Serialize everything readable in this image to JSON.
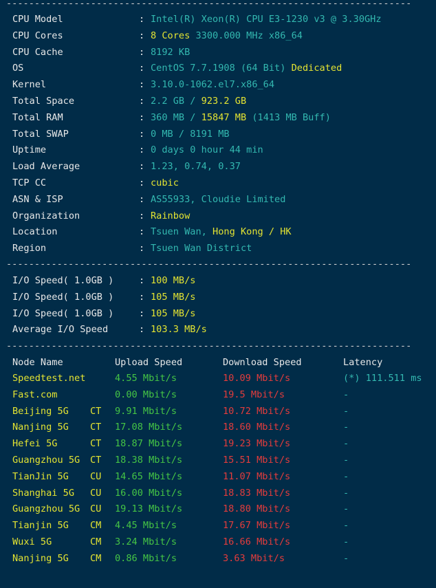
{
  "top_separator": "------------------------------------------------------------------------",
  "system_info": [
    {
      "label": "CPU Model",
      "parts": [
        {
          "text": "Intel(R) Xeon(R) CPU E3-1230 v3 @ 3.30GHz",
          "color": "#33b8b0"
        }
      ]
    },
    {
      "label": "CPU Cores",
      "parts": [
        {
          "text": "8 Cores ",
          "color": "#e4e432"
        },
        {
          "text": "3300.000 MHz x86_64",
          "color": "#33b8b0"
        }
      ]
    },
    {
      "label": "CPU Cache",
      "parts": [
        {
          "text": "8192 KB",
          "color": "#33b8b0"
        }
      ]
    },
    {
      "label": "OS",
      "parts": [
        {
          "text": "CentOS 7.7.1908 (64 Bit) ",
          "color": "#33b8b0"
        },
        {
          "text": "Dedicated",
          "color": "#e4e432"
        }
      ]
    },
    {
      "label": "Kernel",
      "parts": [
        {
          "text": "3.10.0-1062.el7.x86_64",
          "color": "#33b8b0"
        }
      ]
    },
    {
      "label": "Total Space",
      "parts": [
        {
          "text": "2.2 GB / ",
          "color": "#33b8b0"
        },
        {
          "text": "923.2 GB",
          "color": "#e4e432"
        }
      ]
    },
    {
      "label": "Total RAM",
      "parts": [
        {
          "text": "360 MB / ",
          "color": "#33b8b0"
        },
        {
          "text": "15847 MB",
          "color": "#e4e432"
        },
        {
          "text": " (1413 MB Buff)",
          "color": "#33b8b0"
        }
      ]
    },
    {
      "label": "Total SWAP",
      "parts": [
        {
          "text": "0 MB / 8191 MB",
          "color": "#33b8b0"
        }
      ]
    },
    {
      "label": "Uptime",
      "parts": [
        {
          "text": "0 days 0 hour 44 min",
          "color": "#33b8b0"
        }
      ]
    },
    {
      "label": "Load Average",
      "parts": [
        {
          "text": "1.23, 0.74, 0.37",
          "color": "#33b8b0"
        }
      ]
    },
    {
      "label": "TCP CC",
      "parts": [
        {
          "text": "cubic",
          "color": "#e4e432"
        }
      ]
    },
    {
      "label": "ASN & ISP",
      "parts": [
        {
          "text": "AS55933, Cloudie Limited",
          "color": "#33b8b0"
        }
      ]
    },
    {
      "label": "Organization",
      "parts": [
        {
          "text": "Rainbow",
          "color": "#e4e432"
        }
      ]
    },
    {
      "label": "Location",
      "parts": [
        {
          "text": "Tsuen Wan, ",
          "color": "#33b8b0"
        },
        {
          "text": "Hong Kong / HK",
          "color": "#e4e432"
        }
      ]
    },
    {
      "label": "Region",
      "parts": [
        {
          "text": "Tsuen Wan District",
          "color": "#33b8b0"
        }
      ]
    }
  ],
  "separator": "------------------------------------------------------------------------",
  "io_tests": [
    {
      "label": "I/O Speed( 1.0GB )",
      "value": "100 MB/s"
    },
    {
      "label": "I/O Speed( 1.0GB )",
      "value": "105 MB/s"
    },
    {
      "label": "I/O Speed( 1.0GB )",
      "value": "105 MB/s"
    },
    {
      "label": "Average I/O Speed",
      "value": "103.3 MB/s"
    }
  ],
  "separator2": "------------------------------------------------------------------------",
  "speed_headers": {
    "node": "Node Name",
    "upload": "Upload Speed",
    "download": "Download Speed",
    "latency": "Latency"
  },
  "speed_tests": [
    {
      "node": "Speedtest.net",
      "isp": "",
      "upload": "4.55 Mbit/s",
      "download": "10.09 Mbit/s",
      "latency": "(*) 111.511 ms"
    },
    {
      "node": "Fast.com",
      "isp": "",
      "upload": "0.00 Mbit/s",
      "download": "19.5 Mbit/s",
      "latency": "-"
    },
    {
      "node": "Beijing 5G",
      "isp": "CT",
      "upload": "9.91 Mbit/s",
      "download": "10.72 Mbit/s",
      "latency": "-"
    },
    {
      "node": "Nanjing 5G",
      "isp": "CT",
      "upload": "17.08 Mbit/s",
      "download": "18.60 Mbit/s",
      "latency": "-"
    },
    {
      "node": "Hefei 5G",
      "isp": "CT",
      "upload": "18.87 Mbit/s",
      "download": "19.23 Mbit/s",
      "latency": "-"
    },
    {
      "node": "Guangzhou 5G",
      "isp": "CT",
      "upload": "18.38 Mbit/s",
      "download": "15.51 Mbit/s",
      "latency": "-"
    },
    {
      "node": "TianJin 5G",
      "isp": "CU",
      "upload": "14.65 Mbit/s",
      "download": "11.07 Mbit/s",
      "latency": "-"
    },
    {
      "node": "Shanghai 5G",
      "isp": "CU",
      "upload": "16.00 Mbit/s",
      "download": "18.83 Mbit/s",
      "latency": "-"
    },
    {
      "node": "Guangzhou 5G",
      "isp": "CU",
      "upload": "19.13 Mbit/s",
      "download": "18.80 Mbit/s",
      "latency": "-"
    },
    {
      "node": "Tianjin 5G",
      "isp": "CM",
      "upload": "4.45 Mbit/s",
      "download": "17.67 Mbit/s",
      "latency": "-"
    },
    {
      "node": "Wuxi 5G",
      "isp": "CM",
      "upload": "3.24 Mbit/s",
      "download": "16.66 Mbit/s",
      "latency": "-"
    },
    {
      "node": "Nanjing 5G",
      "isp": "CM",
      "upload": "0.86 Mbit/s",
      "download": "3.63 Mbit/s",
      "latency": "-"
    }
  ],
  "colors": {
    "background": "#012c48",
    "label": "#e8e8e8",
    "cyan": "#33b8b0",
    "yellow": "#e4e432",
    "green": "#45c545",
    "red": "#e53c3c"
  },
  "colon": ":"
}
